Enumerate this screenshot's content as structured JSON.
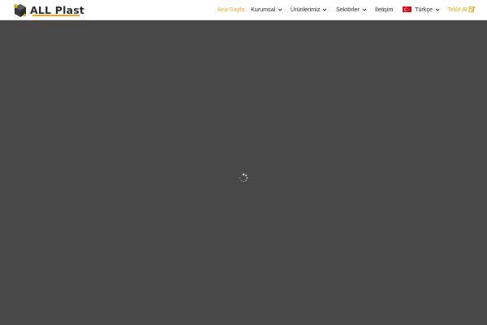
{
  "brand": {
    "name": "ALL Plast",
    "logo_icon": "hexagon-cubes-logo",
    "accent_color": "#e8a823"
  },
  "nav": {
    "home": "Ana Sayfa",
    "corporate": "Kurumsal",
    "products": "Ürünlerimiz",
    "sectors": "Sektörler",
    "contact": "İletişim",
    "language": "Türkçe",
    "quote": "Teklif Al"
  },
  "icons": {
    "dropdown": "chevron-down-icon",
    "language_flag": "turkey-flag-icon",
    "quote": "document-pen-icon",
    "loading": "spinner-icon"
  },
  "colors": {
    "overlay": "#484848",
    "header_bg": "#ffffff",
    "text": "#2a2a2a",
    "active": "#e8a823"
  }
}
